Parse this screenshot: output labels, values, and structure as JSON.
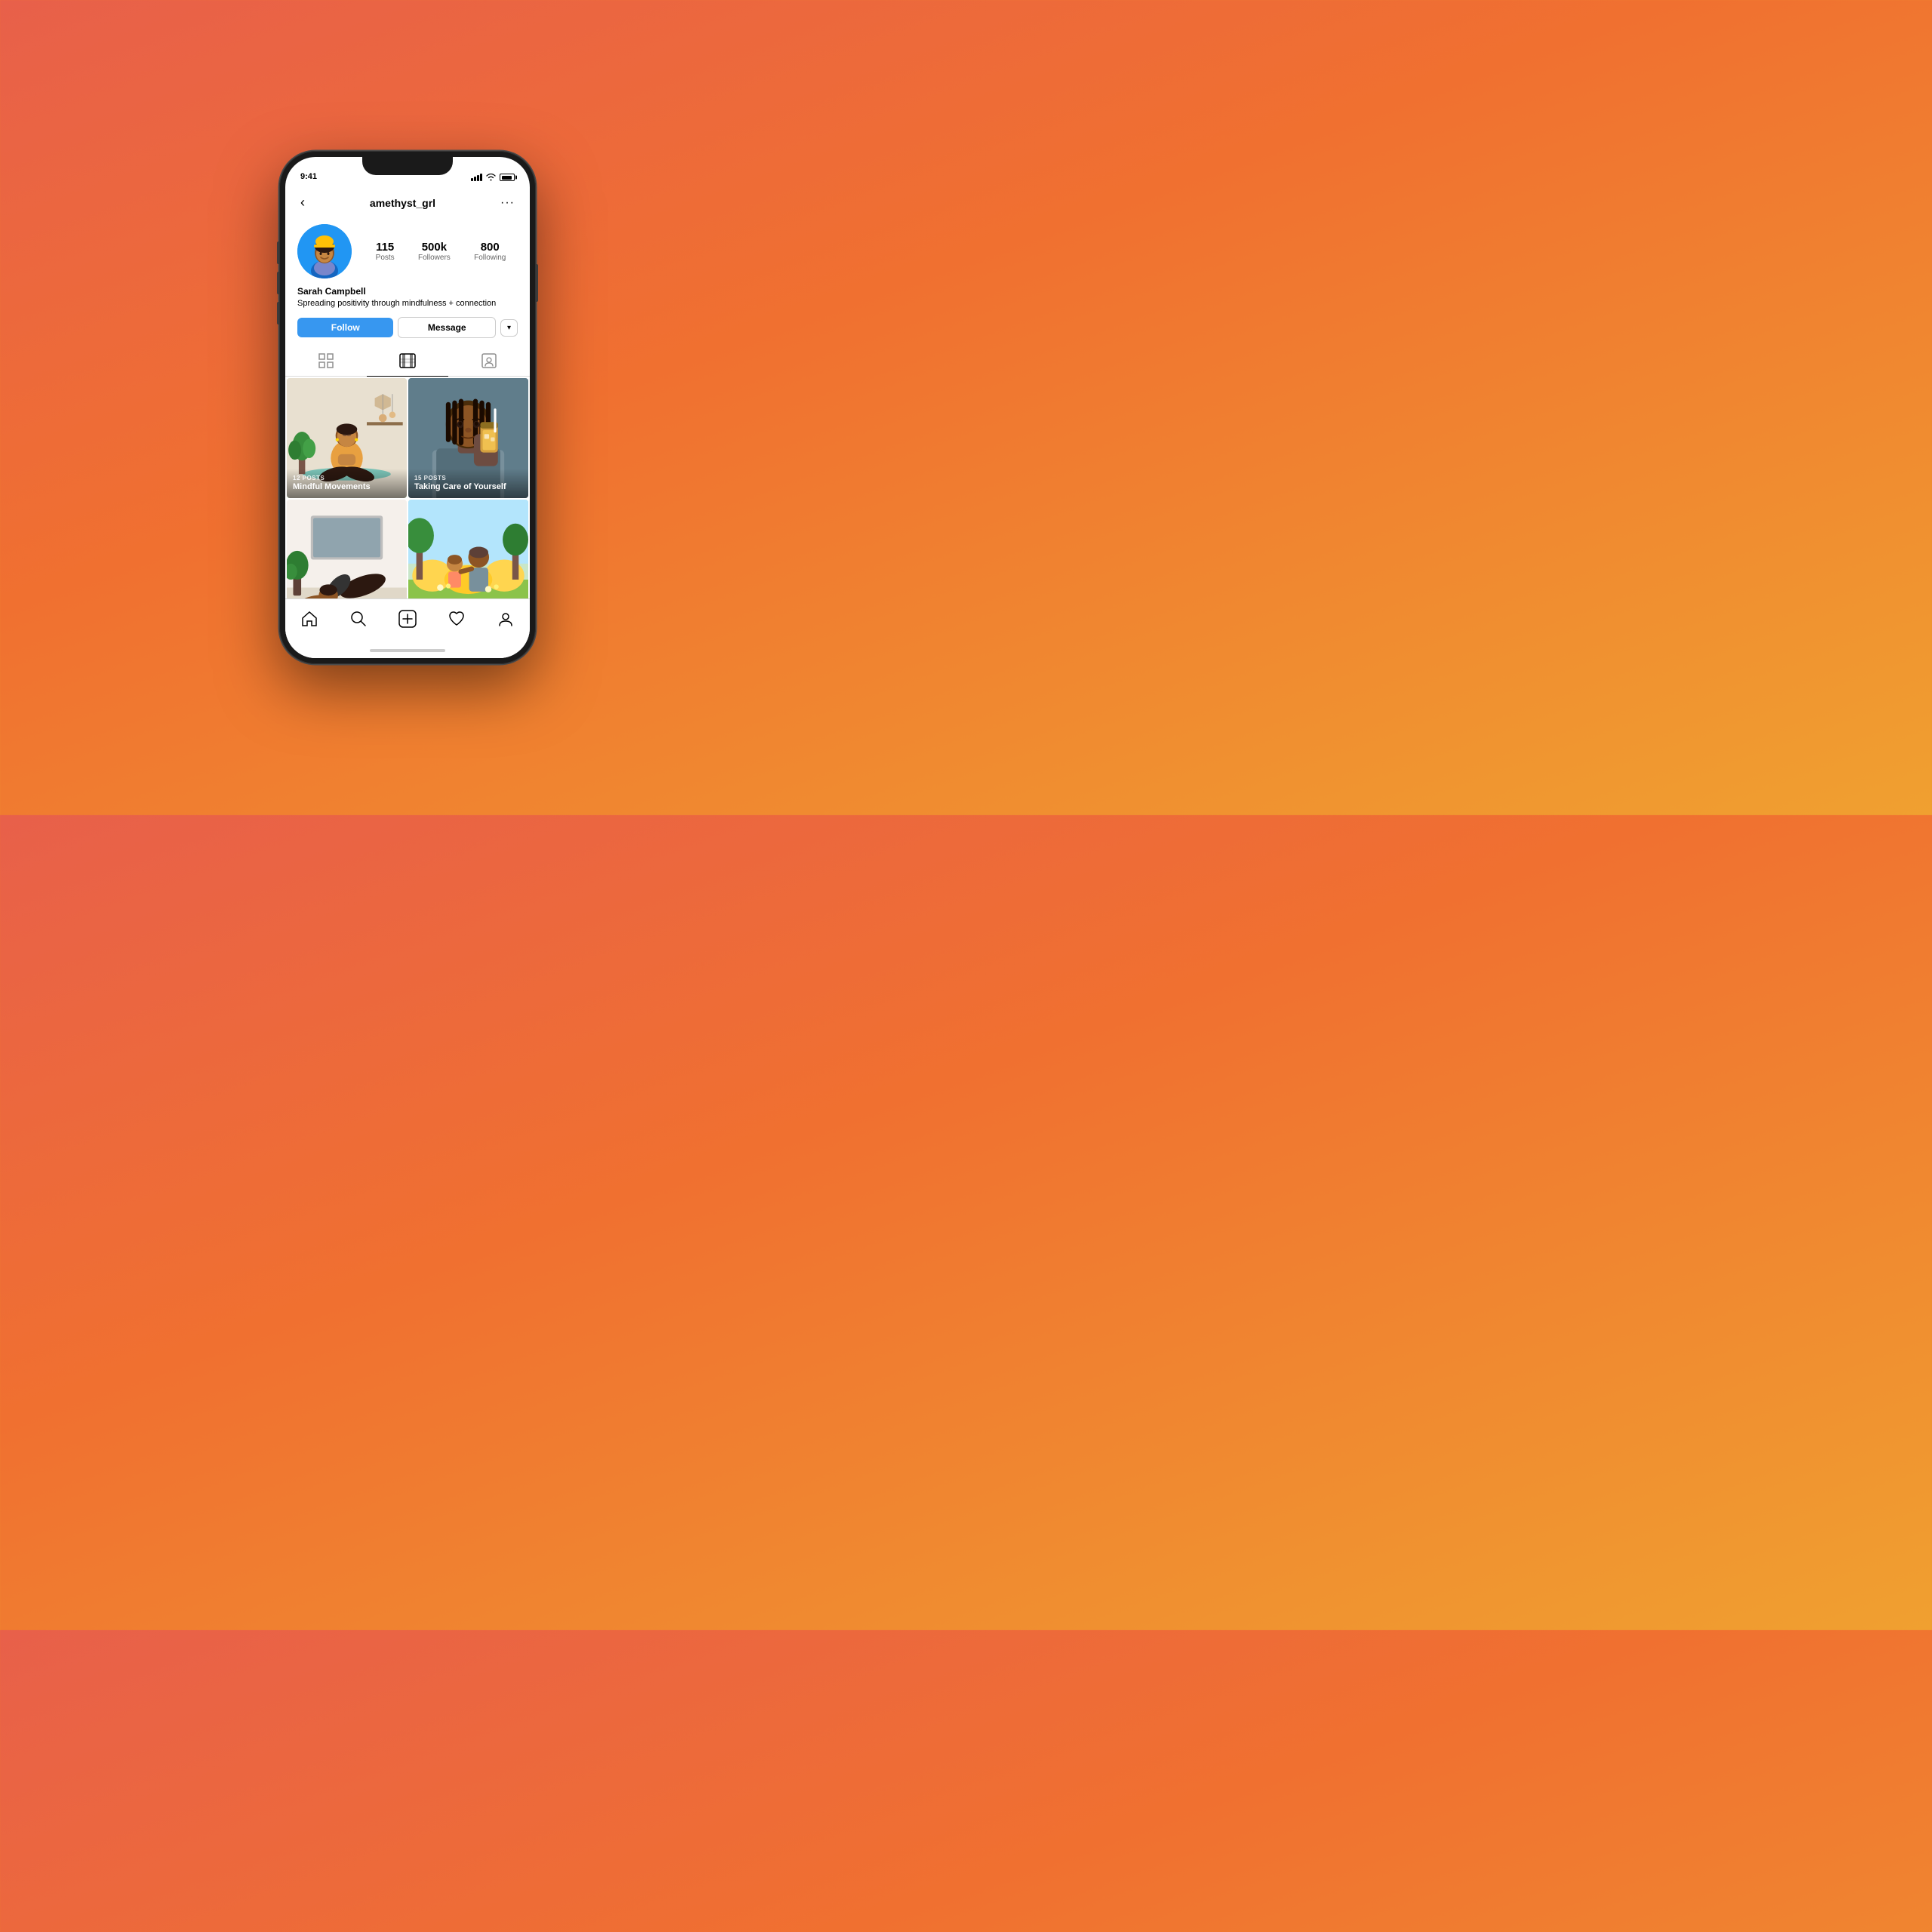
{
  "background": {
    "gradient_start": "#e8604a",
    "gradient_end": "#f0a030"
  },
  "status_bar": {
    "time": "9:41"
  },
  "header": {
    "back_label": "‹",
    "username": "amethyst_grl",
    "more_label": "···"
  },
  "profile": {
    "avatar_alt": "Sarah Campbell avatar",
    "name": "Sarah Campbell",
    "bio": "Spreading positivity through mindfulness + connection",
    "stats": [
      {
        "value": "115",
        "label": "Posts"
      },
      {
        "value": "500k",
        "label": "Followers"
      },
      {
        "value": "800",
        "label": "Following"
      }
    ]
  },
  "action_buttons": {
    "follow_label": "Follow",
    "message_label": "Message",
    "dropdown_label": "▾"
  },
  "tabs": [
    {
      "id": "grid",
      "icon": "⊞",
      "active": false
    },
    {
      "id": "reels",
      "icon": "⊟",
      "active": true
    },
    {
      "id": "tagged",
      "icon": "◻",
      "active": false
    }
  ],
  "posts": [
    {
      "id": "post-1",
      "count": "12 POSTS",
      "title": "Mindful Movements",
      "has_overlay": true
    },
    {
      "id": "post-2",
      "count": "15 POSTS",
      "title": "Taking Care of Yourself",
      "has_overlay": true
    },
    {
      "id": "post-3",
      "count": "",
      "title": "",
      "has_overlay": false
    },
    {
      "id": "post-4",
      "count": "",
      "title": "",
      "has_overlay": false
    }
  ],
  "bottom_nav": [
    {
      "id": "home",
      "icon": "⌂"
    },
    {
      "id": "search",
      "icon": "⌕"
    },
    {
      "id": "add",
      "icon": "⊕"
    },
    {
      "id": "heart",
      "icon": "♡"
    },
    {
      "id": "profile",
      "icon": "⊙"
    }
  ]
}
